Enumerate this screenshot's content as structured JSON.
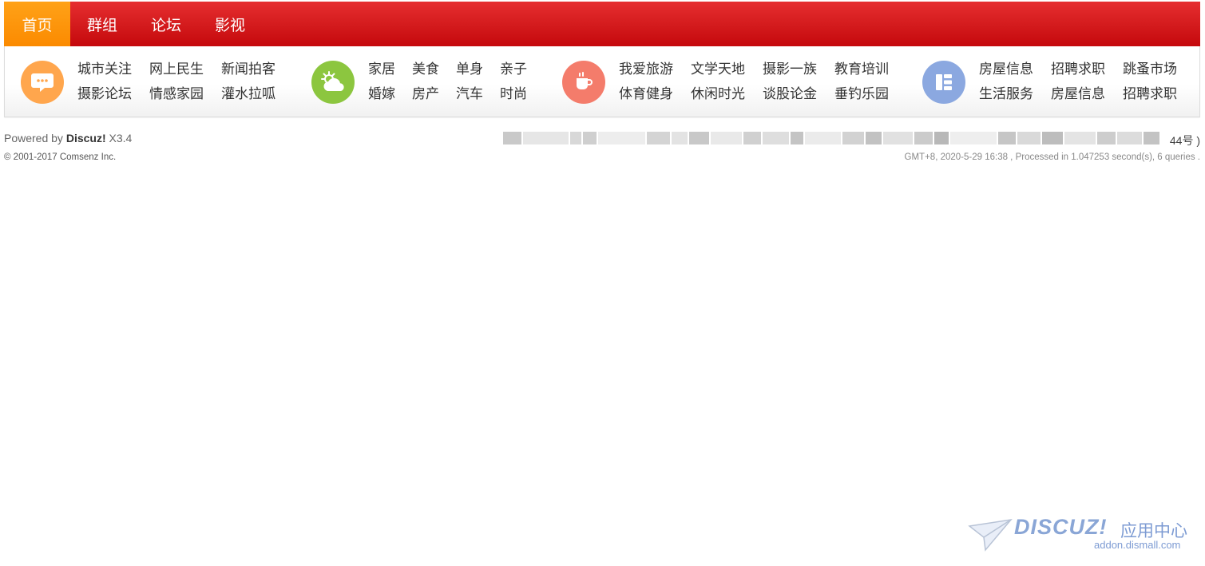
{
  "nav": {
    "items": [
      {
        "label": "首页"
      },
      {
        "label": "群组"
      },
      {
        "label": "论坛"
      },
      {
        "label": "影视"
      }
    ],
    "active_color": "#fb8a00",
    "bar_color": "#d31a1c"
  },
  "categories": [
    {
      "icon": "chat-bubble-icon",
      "color": "#ffa64d",
      "links": [
        "城市关注",
        "网上民生",
        "新闻拍客",
        "摄影论坛",
        "情感家园",
        "灌水拉呱"
      ]
    },
    {
      "icon": "weather-cloud-icon",
      "color": "#8cc63f",
      "links": [
        "家居",
        "美食",
        "单身",
        "亲子",
        "婚嫁",
        "房产",
        "汽车",
        "时尚"
      ]
    },
    {
      "icon": "coffee-cup-icon",
      "color": "#f47c6b",
      "links": [
        "我爱旅游",
        "文学天地",
        "摄影一族",
        "教育培训",
        "体育健身",
        "休闲时光",
        "谈股论金",
        "垂钓乐园"
      ]
    },
    {
      "icon": "list-grid-icon",
      "color": "#8ba8e0",
      "links": [
        "房屋信息",
        "招聘求职",
        "跳蚤市场",
        "生活服务",
        "房屋信息",
        "招聘求职"
      ]
    }
  ],
  "footer": {
    "powered_prefix": "Powered by ",
    "powered_brand": "Discuz!",
    "powered_version": " X3.4",
    "copyright": "© 2001-2017 Comsenz Inc.",
    "icp_suffix": "44号 )",
    "meta": "GMT+8, 2020-5-29 16:38 , Processed in 1.047253 second(s), 6 queries ."
  },
  "watermark": {
    "brand": "DISCUZ!",
    "cn": "应用中心",
    "url": "addon.dismall.com"
  }
}
